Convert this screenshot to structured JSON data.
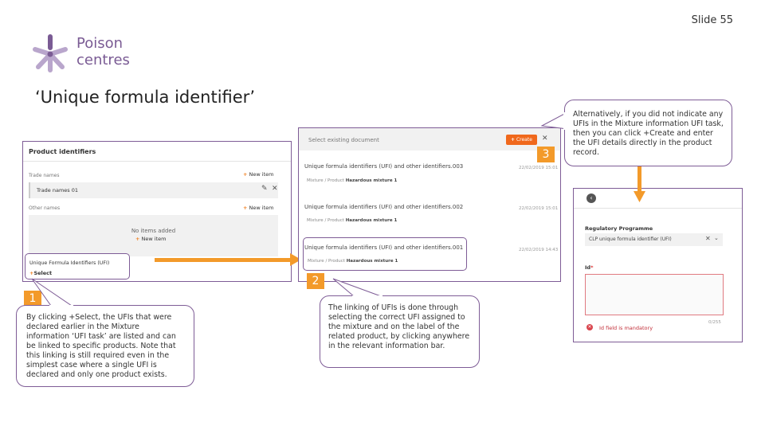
{
  "slide": {
    "number": "Slide 55"
  },
  "logo": {
    "line1": "Poison",
    "line2": "centres"
  },
  "title": "‘Unique formula identifier’",
  "left_panel": {
    "heading": "Product identifiers",
    "trade_names_label": "Trade names",
    "new_item": "New item",
    "trade_name_value": "Trade names 01",
    "other_names_label": "Other names",
    "new_item_2": "New item",
    "no_items": "No items added",
    "new_item_3": "New item",
    "ufi_label": "Unique Formula Identifiers (UFI)",
    "select": "Select"
  },
  "middle_panel": {
    "search_placeholder": "Select existing document",
    "create": "Create",
    "docs": [
      {
        "title": "Unique formula identifiers (UFI) and other identifiers.003",
        "path": "Mixture / Product",
        "mixture": "Hazardous mixture 1",
        "date": "22/02/2019 15:01"
      },
      {
        "title": "Unique formula identifiers (UFI) and other identifiers.002",
        "path": "Mixture / Product",
        "mixture": "Hazardous mixture 1",
        "date": "22/02/2019 15:01"
      },
      {
        "title": "Unique formula identifiers (UFI) and other identifiers.001",
        "path": "Mixture / Product",
        "mixture": "Hazardous mixture 1",
        "date": "22/02/2019 14:43"
      }
    ]
  },
  "right_panel": {
    "reg_label": "Regulatory Programme",
    "reg_value": "CLP unique formula identifier (UFI)",
    "id_label": "Id",
    "counter": "0/255",
    "error": "Id field is mandatory"
  },
  "callouts": {
    "one": "By clicking +Select, the UFIs that were declared earlier in the Mixture information ‘UFI task’ are listed and can be linked to specific products. Note that this linking is still required even in the simplest case where a single UFI is declared and only one product exists.",
    "two": "The linking of UFIs is done through selecting the correct UFI assigned to the mixture and on the label of the related product, by clicking anywhere in the relevant information bar.",
    "three": "Alternatively, if you did not indicate any UFIs in the Mixture information UFI task, then you can click +Create and enter the UFI details directly in the product record."
  },
  "markers": {
    "m1": "1",
    "m2": "2",
    "m3": "3"
  },
  "colors": {
    "accent": "#7e5c96",
    "orange": "#f39a2a",
    "create": "#f0681c"
  }
}
